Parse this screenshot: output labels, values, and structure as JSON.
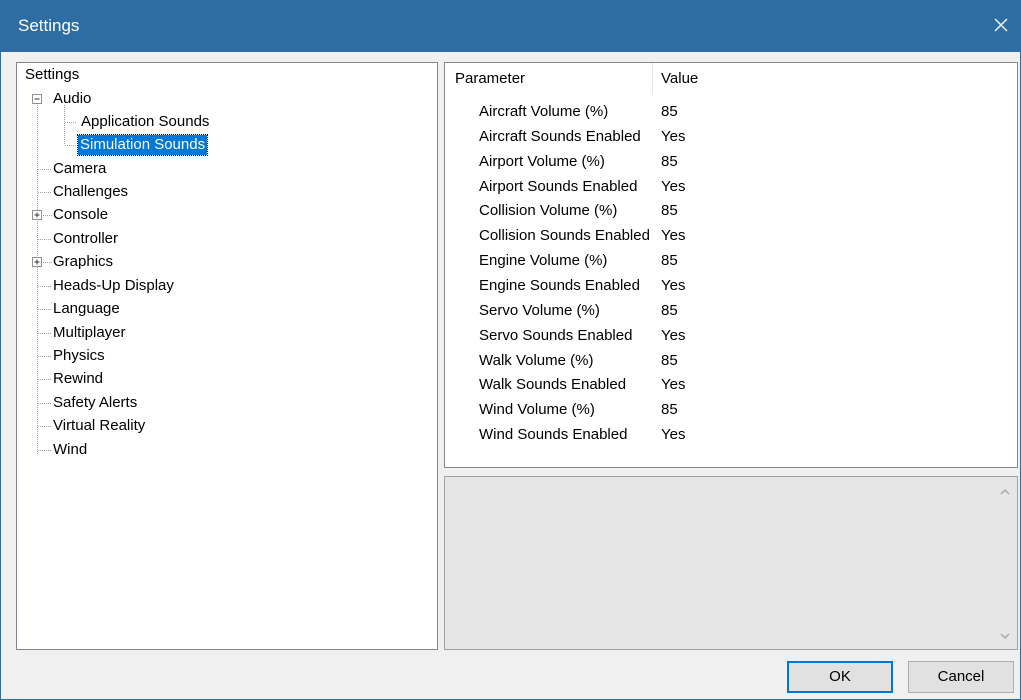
{
  "window": {
    "title": "Settings"
  },
  "tree": {
    "root": "Settings",
    "audio": "Audio",
    "application_sounds": "Application Sounds",
    "simulation_sounds": "Simulation Sounds",
    "camera": "Camera",
    "challenges": "Challenges",
    "console": "Console",
    "controller": "Controller",
    "graphics": "Graphics",
    "heads_up_display": "Heads-Up Display",
    "language": "Language",
    "multiplayer": "Multiplayer",
    "physics": "Physics",
    "rewind": "Rewind",
    "safety_alerts": "Safety Alerts",
    "virtual_reality": "Virtual Reality",
    "wind": "Wind",
    "selected": "Simulation Sounds"
  },
  "grid": {
    "col_parameter": "Parameter",
    "col_value": "Value",
    "rows": [
      {
        "param": "Aircraft Volume (%)",
        "value": "85"
      },
      {
        "param": "Aircraft Sounds Enabled",
        "value": "Yes"
      },
      {
        "param": "Airport Volume (%)",
        "value": "85"
      },
      {
        "param": "Airport Sounds Enabled",
        "value": "Yes"
      },
      {
        "param": "Collision Volume (%)",
        "value": "85"
      },
      {
        "param": "Collision Sounds Enabled",
        "value": "Yes"
      },
      {
        "param": "Engine Volume (%)",
        "value": "85"
      },
      {
        "param": "Engine Sounds Enabled",
        "value": "Yes"
      },
      {
        "param": "Servo Volume (%)",
        "value": "85"
      },
      {
        "param": "Servo Sounds Enabled",
        "value": "Yes"
      },
      {
        "param": "Walk Volume (%)",
        "value": "85"
      },
      {
        "param": "Walk Sounds Enabled",
        "value": "Yes"
      },
      {
        "param": "Wind Volume (%)",
        "value": "85"
      },
      {
        "param": "Wind Sounds Enabled",
        "value": "Yes"
      }
    ]
  },
  "buttons": {
    "ok": "OK",
    "cancel": "Cancel"
  },
  "icons": {
    "close": "close-icon",
    "expand": "plus-box-icon",
    "collapse": "minus-box-icon",
    "scroll_up": "chevron-up-icon",
    "scroll_down": "chevron-down-icon"
  },
  "colors": {
    "titlebar": "#2e6da4",
    "selection": "#0078d7"
  }
}
